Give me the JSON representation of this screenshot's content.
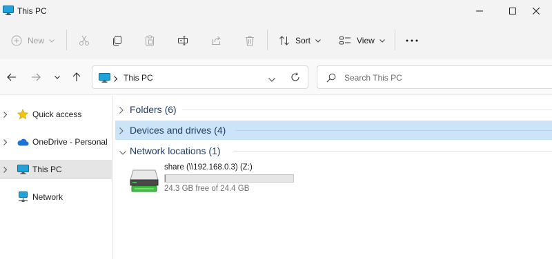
{
  "window": {
    "title": "This PC"
  },
  "toolbar": {
    "new_label": "New",
    "sort_label": "Sort",
    "view_label": "View"
  },
  "address": {
    "breadcrumb": [
      "This PC"
    ]
  },
  "search": {
    "placeholder": "Search This PC"
  },
  "sidebar": {
    "items": [
      {
        "label": "Quick access",
        "icon": "star-icon"
      },
      {
        "label": "OneDrive - Personal",
        "icon": "cloud-icon"
      },
      {
        "label": "This PC",
        "icon": "computer-icon",
        "selected": true
      },
      {
        "label": "Network",
        "icon": "network-icon"
      }
    ]
  },
  "groups": [
    {
      "label": "Folders (6)",
      "expanded": false
    },
    {
      "label": "Devices and drives (4)",
      "expanded": false
    },
    {
      "label": "Network locations (1)",
      "expanded": true
    }
  ],
  "network_drive": {
    "name": "share (\\\\192.168.0.3) (Z:)",
    "free_text": "24.3 GB free of 24.4 GB",
    "used_fraction": 0.004
  },
  "colors": {
    "accent": "#0067c0",
    "selection": "#cce4f7",
    "star": "#f2c40d",
    "onedrive": "#1e73d2",
    "drive_green": "#3cc13c"
  }
}
